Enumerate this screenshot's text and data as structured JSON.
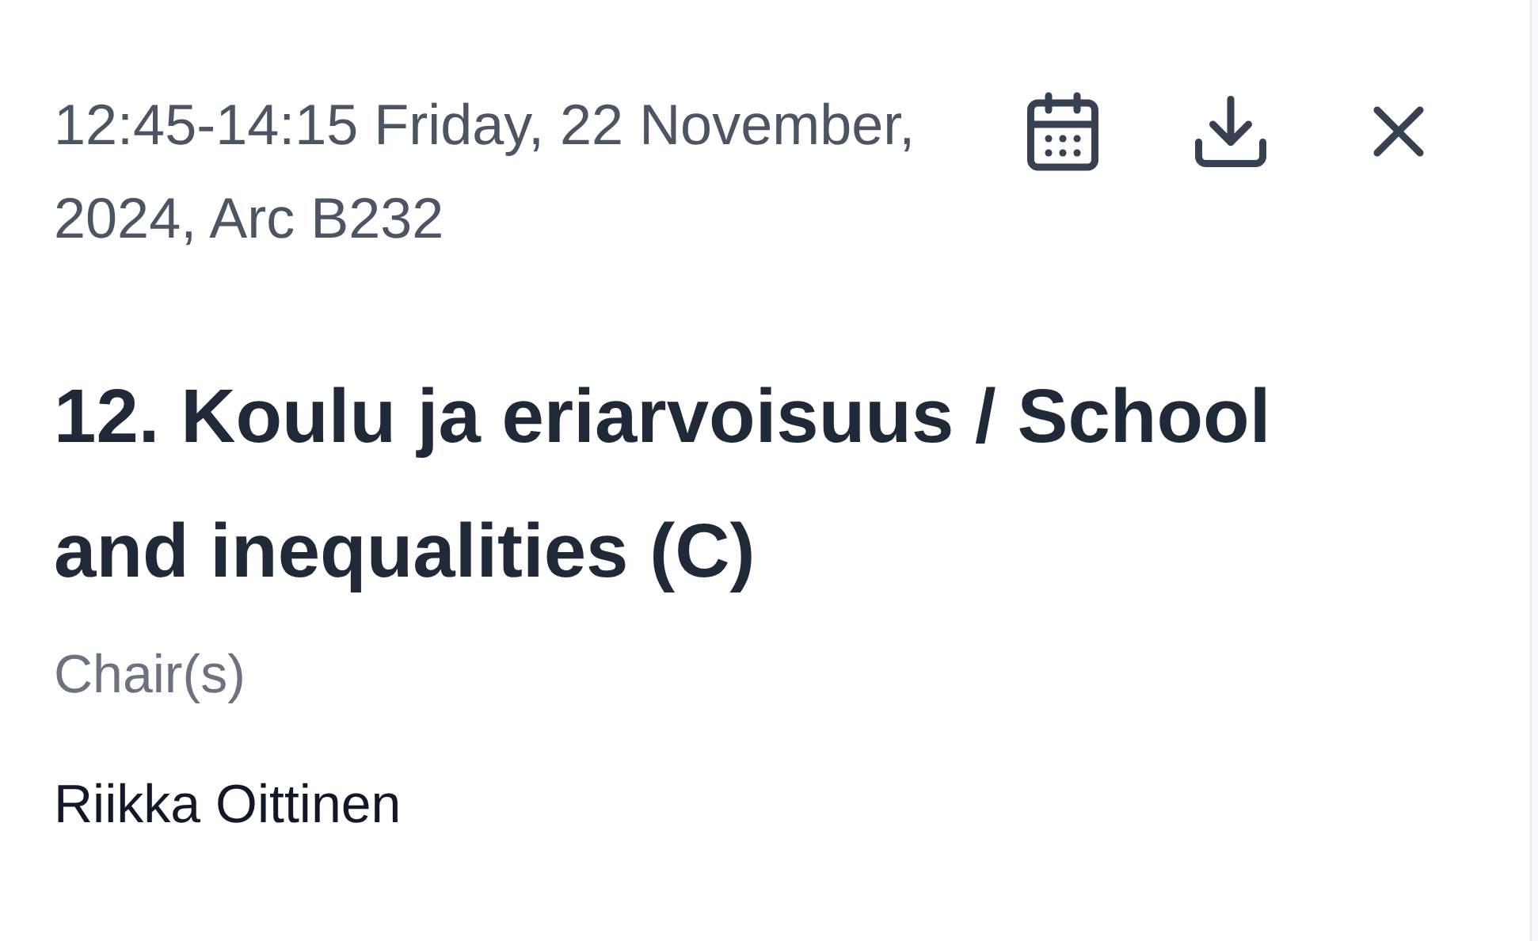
{
  "session": {
    "time_place": "12:45-14:15 Friday, 22 November, 2024, Arc B232",
    "title": "12. Koulu ja eriarvoisuus / School and inequalities (C)",
    "chairs_label": "Chair(s)",
    "chairs": [
      "Riikka Oittinen"
    ]
  }
}
